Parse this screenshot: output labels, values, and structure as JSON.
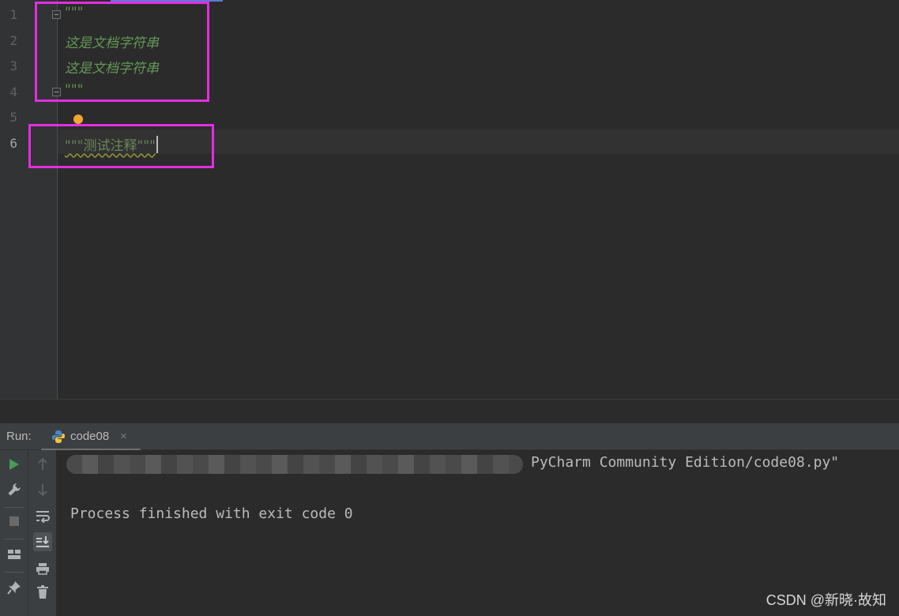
{
  "editor": {
    "line_numbers": [
      "1",
      "2",
      "3",
      "4",
      "5",
      "6"
    ],
    "lines": [
      "\"\"\"",
      "这是文档字符串",
      "这是文档字符串",
      "\"\"\"",
      "",
      "\"\"\"测试注释\"\"\""
    ],
    "active_line": "6"
  },
  "run_panel": {
    "label": "Run:",
    "tab_title": "code08",
    "tab_close": "×",
    "console": {
      "command_tail": "PyCharm Community Edition/code08.py\"",
      "exit_message": "Process finished with exit code 0"
    }
  },
  "watermark": "CSDN @新晓·故知",
  "colors": {
    "highlight_box": "#e22ee2",
    "docstring": "#629755",
    "string": "#6a8759",
    "run_green": "#499c54"
  }
}
